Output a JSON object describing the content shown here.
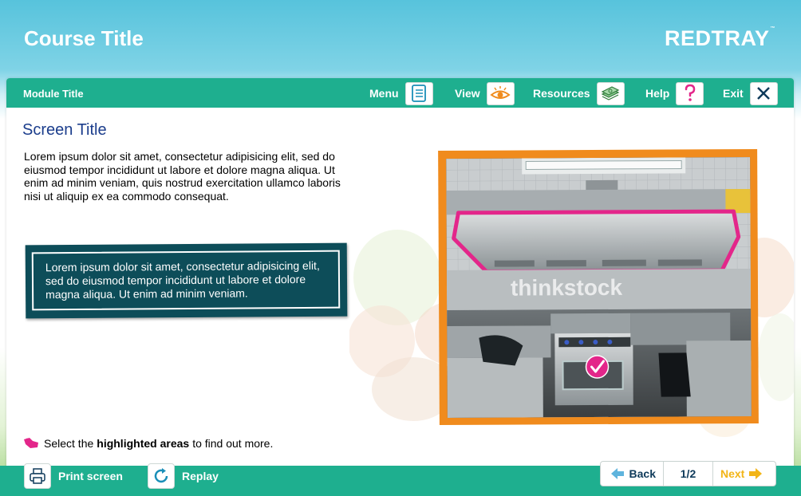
{
  "course": {
    "title": "Course Title"
  },
  "brand": {
    "name": "REDTRAY",
    "tm": "™"
  },
  "module": {
    "title": "Module Title"
  },
  "nav": {
    "menu": {
      "label": "Menu",
      "icon": "menu-list-icon"
    },
    "view": {
      "label": "View",
      "icon": "eye-icon"
    },
    "resources": {
      "label": "Resources",
      "icon": "money-stack-icon"
    },
    "help": {
      "label": "Help",
      "icon": "question-mark-icon"
    },
    "exit": {
      "label": "Exit",
      "icon": "close-icon"
    }
  },
  "screen": {
    "title": "Screen Title",
    "intro": "Lorem ipsum dolor sit amet, consectetur adipisicing elit, sed do eiusmod tempor incididunt ut labore et dolore magna aliqua. Ut enim ad minim veniam, quis nostrud exercitation ullamco laboris nisi ut aliquip ex ea commodo consequat.",
    "callout": "Lorem ipsum dolor sit amet, consectetur adipisicing elit, sed do eiusmod tempor incididunt ut labore et dolore magna aliqua. Ut enim ad minim veniam.",
    "photo_watermark": "thinkstock"
  },
  "hint": {
    "pre": "Select the",
    "highlight": "highlighted areas",
    "post": "to find out more."
  },
  "footer": {
    "print": {
      "label": "Print screen",
      "icon": "printer-icon"
    },
    "replay": {
      "label": "Replay",
      "icon": "replay-icon"
    }
  },
  "pager": {
    "back": "Back",
    "count": "1/2",
    "next": "Next"
  },
  "colors": {
    "teal": "#1eaf8f",
    "title_blue": "#1b3d8c",
    "callout": "#0d4d59",
    "frame_orange": "#f08b1d",
    "highlight_pink": "#e3268a",
    "next_yellow": "#f2b517"
  }
}
